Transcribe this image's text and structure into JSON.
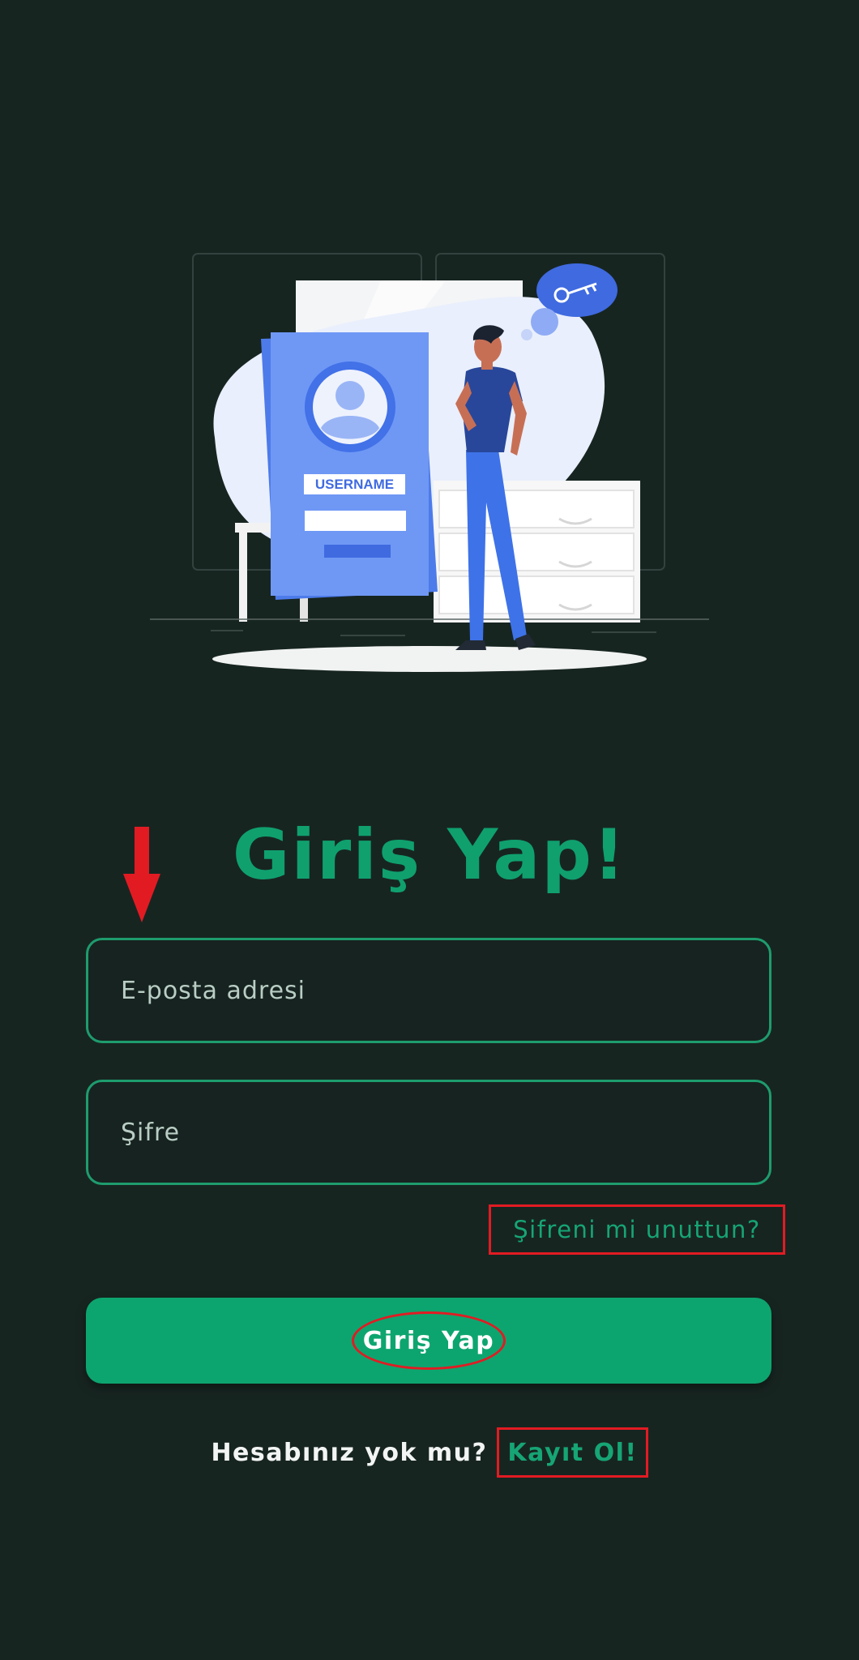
{
  "illustration": {
    "badge_text": "USERNAME",
    "icon": "key-icon"
  },
  "login": {
    "title": "Giriş Yap!",
    "email_placeholder": "E-posta adresi",
    "password_placeholder": "Şifre",
    "forgot_password": "Şifreni mi unuttun?",
    "submit_label": "Giriş Yap"
  },
  "signup": {
    "question": "Hesabınız yok mu?",
    "link": "Kayıt Ol!"
  },
  "colors": {
    "background": "#172521",
    "accent": "#0da56f",
    "annotation": "#e21b23"
  }
}
